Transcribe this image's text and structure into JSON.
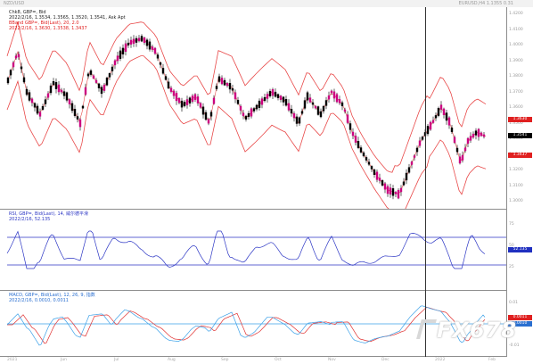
{
  "window": {
    "title_left": "NZD/USD",
    "title_right": "EURUSD,H4  1.1355 0.31"
  },
  "price_pane": {
    "legend_line1": "Chk8, GBP=, Bid",
    "legend_line2": "2022/2/16, 1.3534, 1.3565, 1.3520, 1.3541, Ask Apt",
    "legend_line3": "BBand GBP=, Bid(Last), 20, 2.0",
    "legend_line4": "2022/2/16, 1.3630, 1.3538, 1.3437",
    "ticks": [
      "1.4200",
      "1.4100",
      "1.4000",
      "1.3900",
      "1.3800",
      "1.3700",
      "1.3600",
      "1.3500",
      "1.3400",
      "1.3300",
      "1.3200",
      "1.3100",
      "1.3000"
    ],
    "tags": [
      {
        "text": "1.3630",
        "color": "#e02020"
      },
      {
        "text": "1.3541",
        "color": "#000000"
      },
      {
        "text": "1.3437",
        "color": "#e02020"
      }
    ]
  },
  "rsi_pane": {
    "legend_line1": "RSI, GBP=, Bid(Last), 14, 威尔德平滑",
    "legend_line2": "2022/2/16, 52.135",
    "ticks": [
      "75",
      "50",
      "25"
    ],
    "tags": [
      {
        "text": "52.135",
        "color": "#2030c0"
      }
    ]
  },
  "macd_pane": {
    "legend_line1": "MACD, GBP=, Bid(Last), 12, 26, 9, 指数",
    "legend_line2": "2022/2/16, 0.0010, 0.0011",
    "ticks": [
      "0.01",
      "0.00",
      "-0.01"
    ],
    "tags": [
      {
        "text": "0.0011",
        "color": "#e02020"
      },
      {
        "text": "0.0010",
        "color": "#2a6fd0"
      }
    ]
  },
  "date_axis": {
    "labels": [
      "2021",
      "Jun",
      "Jul",
      "Aug",
      "Sep",
      "Oct",
      "Nov",
      "Dec",
      "2022",
      "Feb"
    ]
  },
  "watermark": {
    "text": "FX678"
  },
  "colors": {
    "candle": "#000000",
    "candle_up": "#cc0080",
    "bollinger": "#e84848",
    "rsi_line": "#2b35c4",
    "rsi_levels": "#2b35c4",
    "macd_line": "#3aa0e8",
    "signal_line": "#e03030",
    "zero_line": "#3aa0e8"
  }
}
